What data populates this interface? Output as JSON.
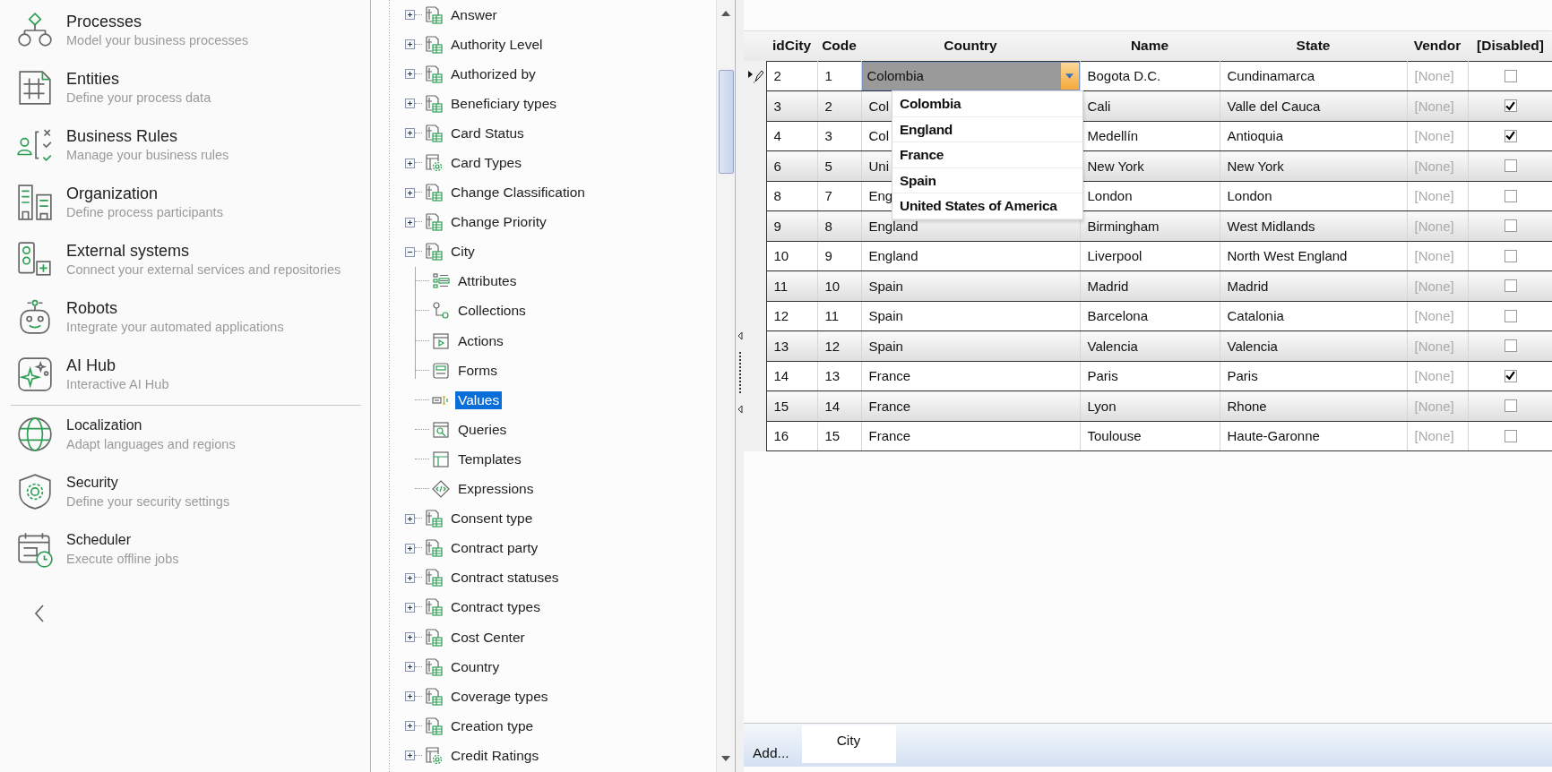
{
  "sidebar": {
    "sections": [
      {
        "items": [
          {
            "kind": "processes",
            "title": "Processes",
            "subtitle": "Model your business processes"
          },
          {
            "kind": "entities",
            "title": "Entities",
            "subtitle": "Define your process data"
          },
          {
            "kind": "rules",
            "title": "Business Rules",
            "subtitle": "Manage your business rules"
          },
          {
            "kind": "organization",
            "title": "Organization",
            "subtitle": "Define process participants"
          },
          {
            "kind": "external",
            "title": "External systems",
            "subtitle": "Connect your external services and repositories"
          },
          {
            "kind": "robots",
            "title": "Robots",
            "subtitle": "Integrate your automated applications"
          },
          {
            "kind": "ai",
            "title": "AI Hub",
            "subtitle": "Interactive AI Hub"
          }
        ]
      },
      {
        "items": [
          {
            "kind": "localization",
            "title": "Localization",
            "subtitle": "Adapt languages and regions"
          },
          {
            "kind": "security",
            "title": "Security",
            "subtitle": "Define your security settings"
          },
          {
            "kind": "scheduler",
            "title": "Scheduler",
            "subtitle": "Execute offline jobs"
          }
        ]
      }
    ]
  },
  "tree": {
    "items": [
      {
        "label": "Answer",
        "kind": "table",
        "expanded": false
      },
      {
        "label": "Authority Level",
        "kind": "table",
        "expanded": false
      },
      {
        "label": "Authorized by",
        "kind": "table",
        "expanded": false
      },
      {
        "label": "Beneficiary types",
        "kind": "table",
        "expanded": false
      },
      {
        "label": "Card Status",
        "kind": "table",
        "expanded": false
      },
      {
        "label": "Card Types",
        "kind": "gear-table",
        "expanded": false
      },
      {
        "label": "Change Classification",
        "kind": "table",
        "expanded": false
      },
      {
        "label": "Change Priority",
        "kind": "table",
        "expanded": false
      },
      {
        "label": "City",
        "kind": "table",
        "expanded": true,
        "children": [
          {
            "label": "Attributes",
            "kind": "attributes",
            "selected": false
          },
          {
            "label": "Collections",
            "kind": "collections",
            "selected": false
          },
          {
            "label": "Actions",
            "kind": "actions",
            "selected": false
          },
          {
            "label": "Forms",
            "kind": "forms",
            "selected": false
          },
          {
            "label": "Values",
            "kind": "values",
            "selected": true
          },
          {
            "label": "Queries",
            "kind": "queries",
            "selected": false
          },
          {
            "label": "Templates",
            "kind": "templates",
            "selected": false
          },
          {
            "label": "Expressions",
            "kind": "expressions",
            "selected": false
          }
        ]
      },
      {
        "label": "Consent type",
        "kind": "table",
        "expanded": false
      },
      {
        "label": "Contract party",
        "kind": "table",
        "expanded": false
      },
      {
        "label": "Contract statuses",
        "kind": "table",
        "expanded": false
      },
      {
        "label": "Contract types",
        "kind": "table",
        "expanded": false
      },
      {
        "label": "Cost Center",
        "kind": "table",
        "expanded": false
      },
      {
        "label": "Country",
        "kind": "table",
        "expanded": false
      },
      {
        "label": "Coverage types",
        "kind": "table",
        "expanded": false
      },
      {
        "label": "Creation type",
        "kind": "table",
        "expanded": false
      },
      {
        "label": "Credit Ratings",
        "kind": "gear-table",
        "expanded": false
      }
    ]
  },
  "grid": {
    "columns": [
      {
        "label": "idCity",
        "kind": "text"
      },
      {
        "label": "Code",
        "kind": "text"
      },
      {
        "label": "Country",
        "kind": "combo"
      },
      {
        "label": "Name",
        "kind": "text"
      },
      {
        "label": "State",
        "kind": "text"
      },
      {
        "label": "Vendor",
        "kind": "lookup"
      },
      {
        "label": "[Disabled]",
        "kind": "check"
      }
    ],
    "rows": [
      {
        "editing": true,
        "cells": [
          "2",
          "1",
          "Colombia",
          "Bogota D.C.",
          "Cundinamarca",
          "[None]"
        ],
        "disabled": false
      },
      {
        "editing": false,
        "cells": [
          "3",
          "2",
          "Col",
          "Cali",
          "Valle del Cauca",
          "[None]"
        ],
        "disabled": true
      },
      {
        "editing": false,
        "cells": [
          "4",
          "3",
          "Col",
          "Medellín",
          "Antioquia",
          "[None]"
        ],
        "disabled": true
      },
      {
        "editing": false,
        "cells": [
          "6",
          "5",
          "Uni",
          "New York",
          "New York",
          "[None]"
        ],
        "disabled": false
      },
      {
        "editing": false,
        "cells": [
          "8",
          "7",
          "Eng",
          "London",
          "London",
          "[None]"
        ],
        "disabled": false
      },
      {
        "editing": false,
        "cells": [
          "9",
          "8",
          "England",
          "Birmingham",
          "West Midlands",
          "[None]"
        ],
        "disabled": false
      },
      {
        "editing": false,
        "cells": [
          "10",
          "9",
          "England",
          "Liverpool",
          "North West England",
          "[None]"
        ],
        "disabled": false
      },
      {
        "editing": false,
        "cells": [
          "11",
          "10",
          "Spain",
          "Madrid",
          "Madrid",
          "[None]"
        ],
        "disabled": false
      },
      {
        "editing": false,
        "cells": [
          "12",
          "11",
          "Spain",
          "Barcelona",
          "Catalonia",
          "[None]"
        ],
        "disabled": false
      },
      {
        "editing": false,
        "cells": [
          "13",
          "12",
          "Spain",
          "Valencia",
          "Valencia",
          "[None]"
        ],
        "disabled": false
      },
      {
        "editing": false,
        "cells": [
          "14",
          "13",
          "France",
          "Paris",
          "Paris",
          "[None]"
        ],
        "disabled": true
      },
      {
        "editing": false,
        "cells": [
          "15",
          "14",
          "France",
          "Lyon",
          "Rhone",
          "[None]"
        ],
        "disabled": false
      },
      {
        "editing": false,
        "cells": [
          "16",
          "15",
          "France",
          "Toulouse",
          "Haute-Garonne",
          "[None]"
        ],
        "disabled": false
      }
    ],
    "dropdown": {
      "options": [
        "Colombia",
        "England",
        "France",
        "Spain",
        "United States of America"
      ]
    }
  },
  "bottom_bar": {
    "add_button": "Add...",
    "tabs": [
      {
        "label": "City",
        "selected": true
      }
    ]
  }
}
